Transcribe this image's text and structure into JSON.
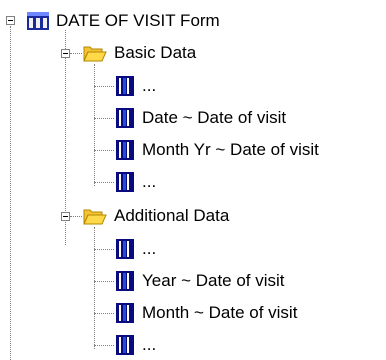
{
  "tree": {
    "root": {
      "label": "DATE OF VISIT Form",
      "icon": "form-table-icon",
      "groups": [
        {
          "label": "Basic Data",
          "icon": "open-folder-icon",
          "items": [
            {
              "label": "...",
              "icon": "field-icon"
            },
            {
              "label": "Date ~ Date of visit",
              "icon": "field-icon"
            },
            {
              "label": "Month Yr ~ Date of visit",
              "icon": "field-icon"
            },
            {
              "label": "...",
              "icon": "field-icon"
            }
          ]
        },
        {
          "label": "Additional Data",
          "icon": "open-folder-icon",
          "items": [
            {
              "label": "...",
              "icon": "field-icon"
            },
            {
              "label": "Year ~ Date of visit",
              "icon": "field-icon"
            },
            {
              "label": "Month ~ Date of visit",
              "icon": "field-icon"
            },
            {
              "label": "...",
              "icon": "field-icon"
            }
          ]
        }
      ]
    }
  },
  "colors": {
    "tree_lines": "#808080",
    "folder_fill": "#ffd94a",
    "folder_edge": "#b08800",
    "field_blue": "#0a0a80",
    "form_blue": "#1a2a9a"
  }
}
